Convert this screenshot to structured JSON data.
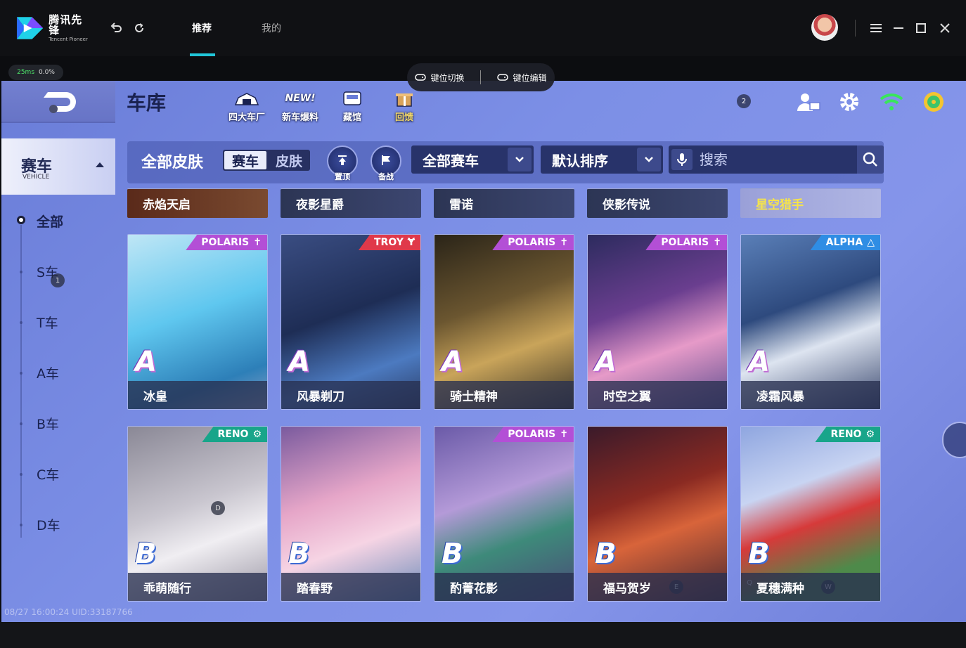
{
  "app": {
    "logo_zh": "腾讯先锋",
    "logo_en": "Tencent Pioneer",
    "tabs": [
      "推荐",
      "我的"
    ]
  },
  "status": {
    "ping": "25ms",
    "loss": "0.0%"
  },
  "keybar": {
    "switch_label": "键位切换",
    "edit_label": "键位编辑"
  },
  "sidebar": {
    "category_zh": "赛车",
    "category_en": "VEHICLE",
    "items": [
      "全部",
      "S车",
      "T车",
      "A车",
      "B车",
      "C车",
      "D车"
    ]
  },
  "header": {
    "title": "车库",
    "buttons": [
      "四大车厂",
      "新车爆料",
      "藏馆",
      "回馈"
    ],
    "new_tag": "NEW!",
    "notification_count": "2"
  },
  "filter": {
    "all_skins": "全部皮肤",
    "seg": [
      "赛车",
      "皮肤"
    ],
    "pin_label": "置顶",
    "ready_label": "备战",
    "vehicle_dropdown": "全部赛车",
    "sort_dropdown": "默认排序",
    "search_placeholder": "搜索"
  },
  "series": [
    "赤焰天启",
    "夜影星爵",
    "雷诺",
    "侠影传说",
    "星空猎手"
  ],
  "cards": [
    {
      "name": "冰皇",
      "grade": "A",
      "brand": "POLARIS"
    },
    {
      "name": "风暴剃刀",
      "grade": "A",
      "brand": "TROY"
    },
    {
      "name": "骑士精神",
      "grade": "A",
      "brand": "POLARIS"
    },
    {
      "name": "时空之翼",
      "grade": "A",
      "brand": "POLARIS"
    },
    {
      "name": "凌霜风暴",
      "grade": "A",
      "brand": "ALPHA"
    },
    {
      "name": "乖萌随行",
      "grade": "B",
      "brand": "RENO"
    },
    {
      "name": "踏春野",
      "grade": "B",
      "brand": ""
    },
    {
      "name": "酌菁花影",
      "grade": "B",
      "brand": "POLARIS"
    },
    {
      "name": "福马贺岁",
      "grade": "B",
      "brand": ""
    },
    {
      "name": "夏穗满种",
      "grade": "B",
      "brand": "RENO"
    }
  ],
  "hotkeys": {
    "s_badge": "1",
    "d_badge": "D",
    "e_badge": "E",
    "q_badge": "Q",
    "w_badge": "W"
  },
  "footer": {
    "timestamp": "08/27 16:00:24 UID:33187766"
  },
  "colors": {
    "accent": "#21c6d9",
    "bg_game": "#7c8fe6",
    "polaris": "#b34fd6",
    "troy": "#e0394a",
    "alpha": "#2f8de4",
    "reno": "#18a58a"
  }
}
